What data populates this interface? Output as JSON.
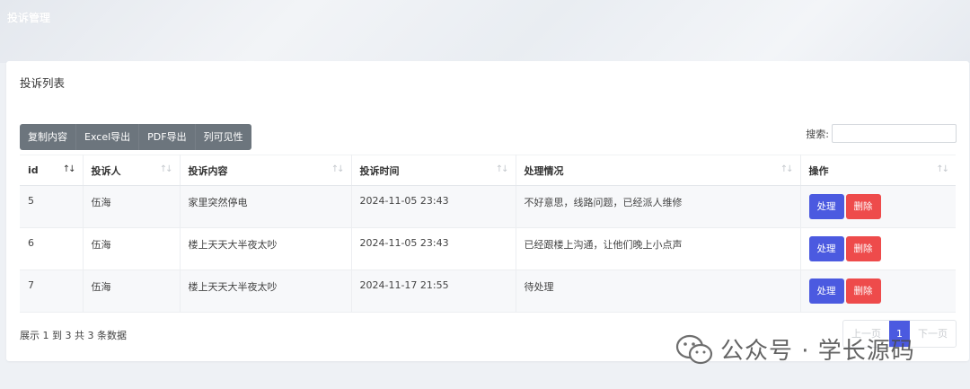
{
  "page": {
    "title": "投诉管理"
  },
  "card": {
    "title": "投诉列表"
  },
  "toolbar": {
    "buttons": [
      "复制内容",
      "Excel导出",
      "PDF导出",
      "列可见性"
    ]
  },
  "search": {
    "label": "搜索:",
    "value": ""
  },
  "table": {
    "columns": [
      "id",
      "投诉人",
      "投诉内容",
      "投诉时间",
      "处理情况",
      "操作"
    ],
    "rows": [
      {
        "id": "5",
        "person": "伍海",
        "content": "家里突然停电",
        "time": "2024-11-05 23:43",
        "status": "不好意思，线路问题，已经派人维修"
      },
      {
        "id": "6",
        "person": "伍海",
        "content": "楼上天天大半夜太吵",
        "time": "2024-11-05 23:43",
        "status": "已经跟楼上沟通，让他们晚上小点声"
      },
      {
        "id": "7",
        "person": "伍海",
        "content": "楼上天天大半夜太吵",
        "time": "2024-11-17 21:55",
        "status": "待处理"
      }
    ],
    "row_actions": {
      "process": "处理",
      "delete": "删除"
    }
  },
  "footer": {
    "info": "展示 1 到 3 共 3 条数据"
  },
  "pager": {
    "prev": "上一页",
    "current": "1",
    "next": "下一页"
  },
  "watermark": {
    "text": "公众号 · 学长源码"
  },
  "colors": {
    "primary": "#4b5ae0",
    "danger": "#ee4b4b",
    "toolbar": "#6c757d"
  }
}
